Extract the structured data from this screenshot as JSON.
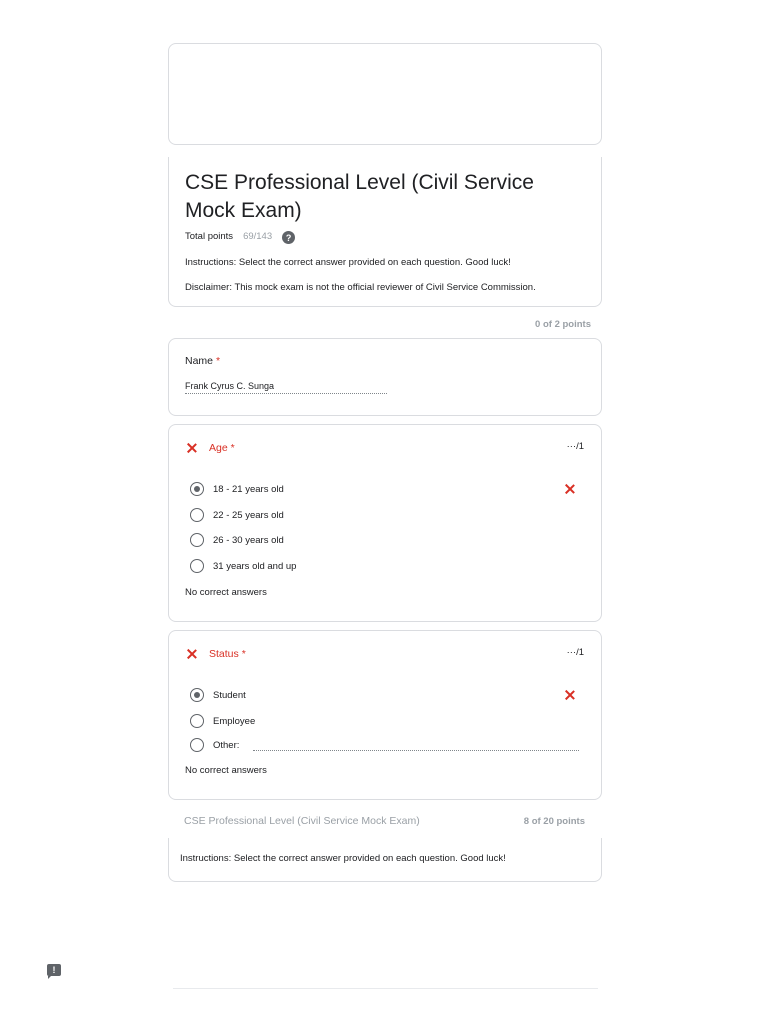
{
  "header": {
    "title": "CSE Professional Level (Civil Service Mock Exam)",
    "total_points_label": "Total points",
    "total_points_value": "69/143",
    "help_icon": "?",
    "instructions": "Instructions: Select the correct answer provided on each question. Good luck!",
    "disclaimer": "Disclaimer: This mock exam is not the official reviewer of Civil Service Commission."
  },
  "section1": {
    "points": "0 of 2 points"
  },
  "name_question": {
    "label": "Name",
    "required": "*",
    "answer": "Frank Cyrus C. Sunga"
  },
  "age_question": {
    "label": "Age",
    "required": "*",
    "score": "···/1",
    "options": [
      "18 - 21 years old",
      "22 - 25 years old",
      "26 - 30 years old",
      "31 years old and up"
    ],
    "selected_index": 0,
    "feedback": "No correct answers"
  },
  "status_question": {
    "label": "Status",
    "required": "*",
    "score": "···/1",
    "options": [
      "Student",
      "Employee",
      "Other:"
    ],
    "selected_index": 0,
    "feedback": "No correct answers"
  },
  "section2": {
    "title": "CSE Professional Level (Civil Service Mock Exam)",
    "points": "8 of 20 points",
    "instructions": "Instructions: Select the correct answer provided on each question. Good luck!"
  },
  "icons": {
    "incorrect": "x-icon",
    "help": "help-icon",
    "feedback": "feedback-icon"
  },
  "colors": {
    "incorrect": "#d93025",
    "muted": "#9aa0a6",
    "icon": "#5f6368"
  }
}
